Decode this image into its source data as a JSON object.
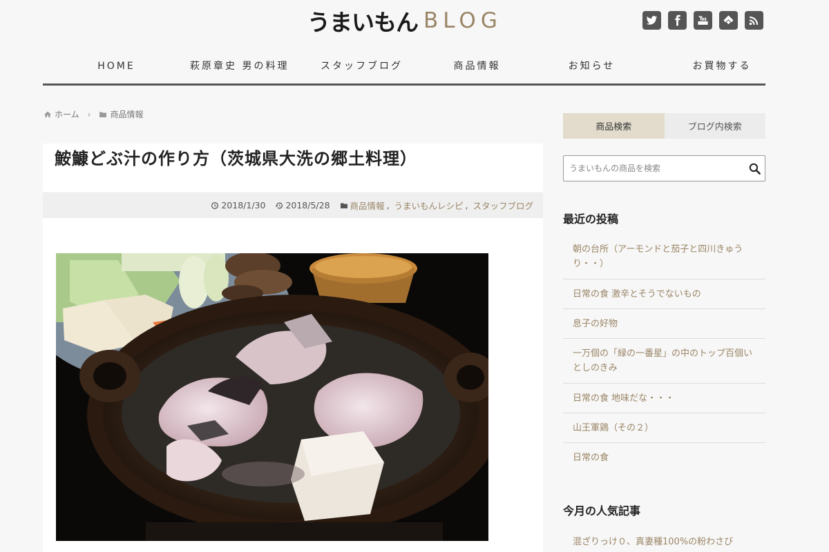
{
  "header": {
    "logo_script": "うまいもん",
    "logo_blog": "BLOG",
    "social": [
      "twitter-icon",
      "facebook-icon",
      "youtube-icon",
      "feedly-icon",
      "rss-icon"
    ]
  },
  "nav": {
    "items": [
      {
        "label": "HOME"
      },
      {
        "label": "萩原章史 男の料理"
      },
      {
        "label": "スタッフブログ"
      },
      {
        "label": "商品情報"
      },
      {
        "label": "お知らせ"
      },
      {
        "label": "お買物する"
      }
    ]
  },
  "breadcrumb": {
    "home": "ホーム",
    "category": "商品情報"
  },
  "article": {
    "title": "鮟鱇どぶ汁の作り方（茨城県大洗の郷土料理）",
    "published": "2018/1/30",
    "updated": "2018/5/28",
    "categories": [
      "商品情報",
      "うまいもんレシピ",
      "スタッフブログ"
    ]
  },
  "sidebar": {
    "search_tab_active": "商品検索",
    "search_tab_inactive": "ブログ内検索",
    "search_placeholder": "うまいもんの商品を検索",
    "recent_heading": "最近の投稿",
    "recent_posts": [
      "朝の台所（アーモンドと茄子と四川きゅうり・・）",
      "日常の食 激辛とそうでないもの",
      "息子の好物",
      "一万個の「緑の一番星」の中のトップ百個いとしのきみ",
      "日常の食 地味だな・・・",
      "山王軍鶏（その２）",
      "日常の食"
    ],
    "popular_heading": "今月の人気記事",
    "popular_posts": [
      "混ざりっけ０、真妻種100%の粉わさび"
    ]
  }
}
